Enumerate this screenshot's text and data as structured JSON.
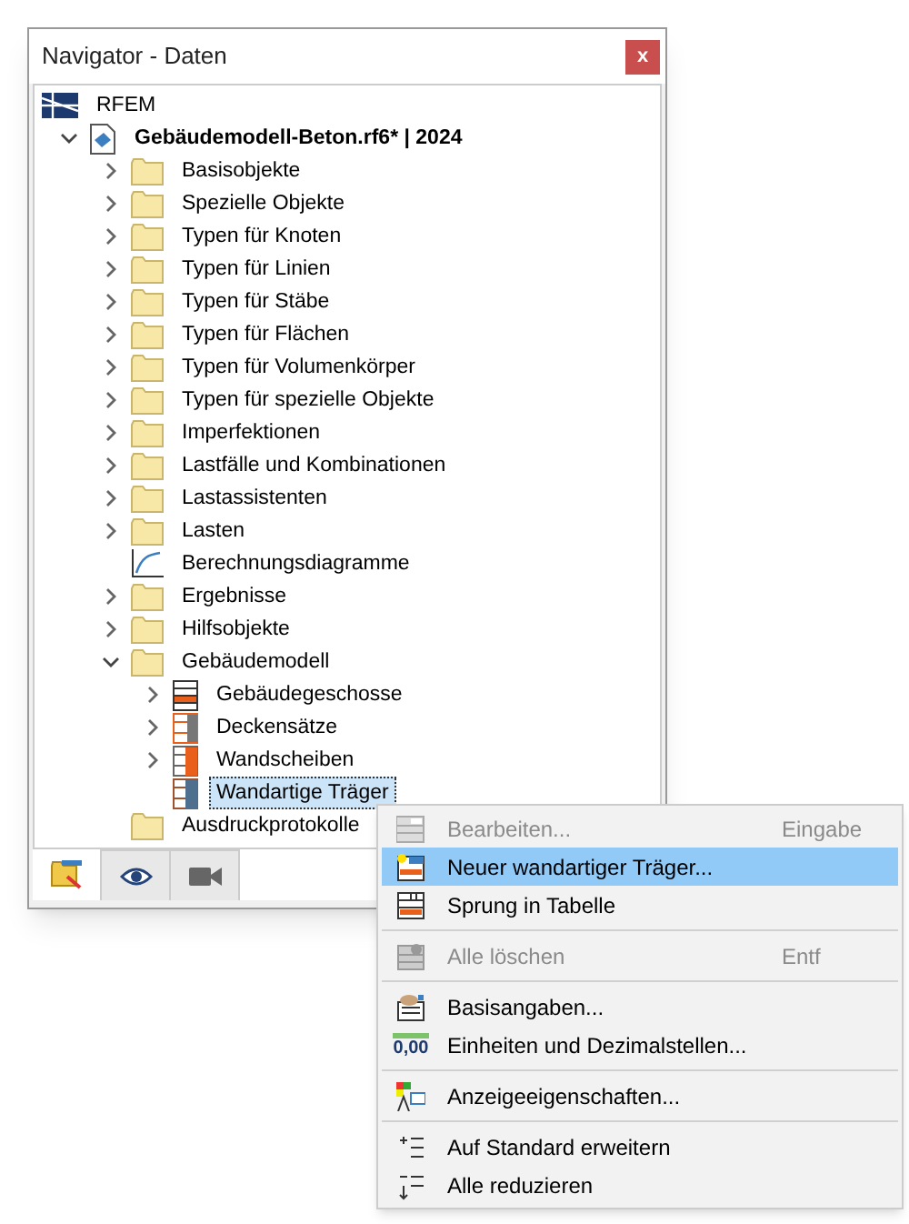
{
  "window": {
    "title": "Navigator - Daten",
    "close": "x"
  },
  "tree": [
    {
      "label": "RFEM",
      "kind": "app",
      "children": [
        {
          "label": "Gebäudemodell-Beton.rf6* | 2024",
          "kind": "file",
          "expanded": true,
          "children": [
            {
              "label": "Basisobjekte",
              "kind": "folder",
              "expanded": false
            },
            {
              "label": "Spezielle Objekte",
              "kind": "folder",
              "expanded": false
            },
            {
              "label": "Typen für Knoten",
              "kind": "folder",
              "expanded": false
            },
            {
              "label": "Typen für Linien",
              "kind": "folder",
              "expanded": false
            },
            {
              "label": "Typen für Stäbe",
              "kind": "folder",
              "expanded": false
            },
            {
              "label": "Typen für Flächen",
              "kind": "folder",
              "expanded": false
            },
            {
              "label": "Typen für Volumenkörper",
              "kind": "folder",
              "expanded": false
            },
            {
              "label": "Typen für spezielle Objekte",
              "kind": "folder",
              "expanded": false
            },
            {
              "label": "Imperfektionen",
              "kind": "folder",
              "expanded": false
            },
            {
              "label": "Lastfälle und Kombinationen",
              "kind": "folder",
              "expanded": false
            },
            {
              "label": "Lastassistenten",
              "kind": "folder",
              "expanded": false
            },
            {
              "label": "Lasten",
              "kind": "folder",
              "expanded": false
            },
            {
              "label": "Berechnungsdiagramme",
              "kind": "diagram"
            },
            {
              "label": "Ergebnisse",
              "kind": "folder",
              "expanded": false
            },
            {
              "label": "Hilfsobjekte",
              "kind": "folder",
              "expanded": false
            },
            {
              "label": "Gebäudemodell",
              "kind": "folder",
              "expanded": true,
              "children": [
                {
                  "label": "Gebäudegeschosse",
                  "kind": "stories",
                  "expanded": false,
                  "selected": false
                },
                {
                  "label": "Deckensätze",
                  "kind": "slabs",
                  "expanded": false,
                  "selected": false
                },
                {
                  "label": "Wandscheiben",
                  "kind": "walls",
                  "expanded": false,
                  "selected": false
                },
                {
                  "label": "Wandartige Träger",
                  "kind": "deepbeams",
                  "selected": true
                }
              ]
            },
            {
              "label": "Ausdruckprotokolle",
              "kind": "folder"
            }
          ]
        }
      ]
    }
  ],
  "bottom_tabs": [
    {
      "kind": "data",
      "selected": true
    },
    {
      "kind": "view",
      "selected": false
    },
    {
      "kind": "camera",
      "selected": false
    }
  ],
  "context_menu": [
    [
      {
        "label": "Bearbeiten...",
        "shortcut": "Eingabe",
        "kind": "edit",
        "disabled": true,
        "selected": false
      },
      {
        "label": "Neuer wandartiger Träger...",
        "kind": "new",
        "disabled": false,
        "selected": true
      },
      {
        "label": "Sprung in Tabelle",
        "kind": "table",
        "disabled": false,
        "selected": false
      }
    ],
    [
      {
        "label": "Alle löschen",
        "shortcut": "Entf",
        "kind": "delete",
        "disabled": true,
        "selected": false
      }
    ],
    [
      {
        "label": "Basisangaben...",
        "kind": "base",
        "disabled": false,
        "selected": false
      },
      {
        "label": "Einheiten und Dezimalstellen...",
        "kind": "units",
        "icon_text": "0,00",
        "disabled": false,
        "selected": false
      }
    ],
    [
      {
        "label": "Anzeigeeigenschaften...",
        "kind": "display",
        "disabled": false,
        "selected": false
      }
    ],
    [
      {
        "label": "Auf Standard erweitern",
        "kind": "expand",
        "disabled": false,
        "selected": false
      },
      {
        "label": "Alle reduzieren",
        "kind": "collapse",
        "disabled": false,
        "selected": false
      }
    ]
  ]
}
